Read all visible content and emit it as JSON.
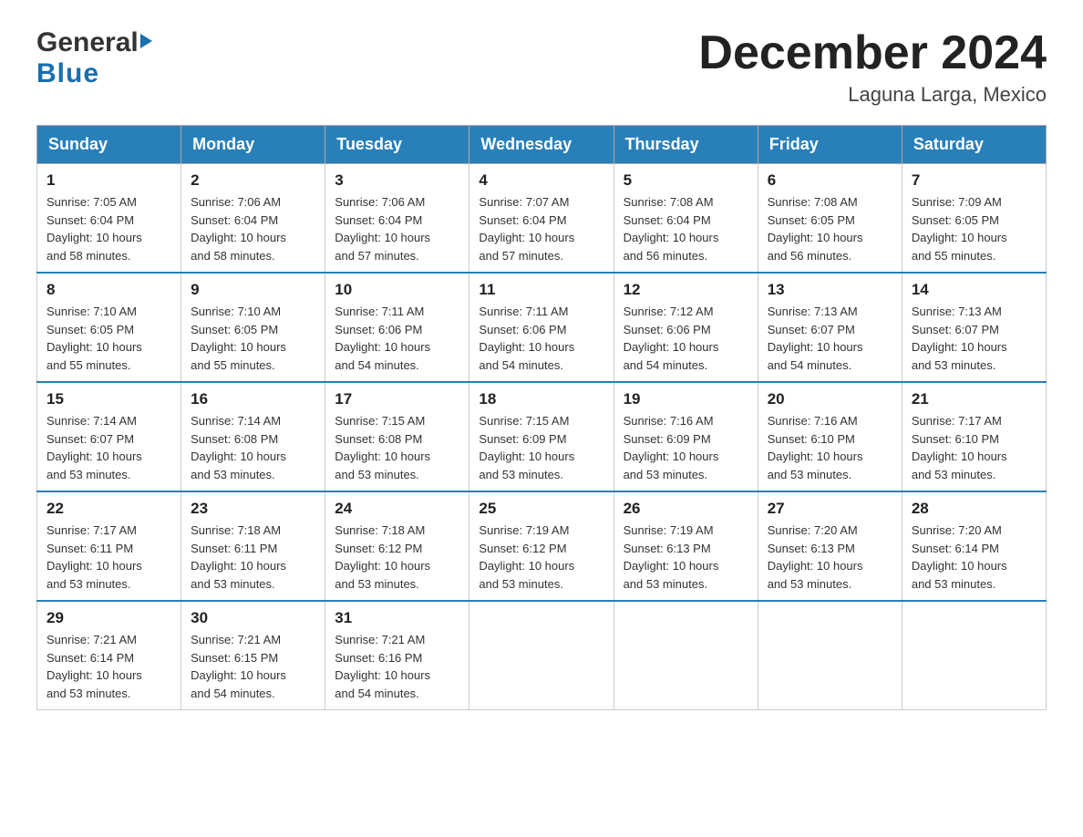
{
  "header": {
    "logo": {
      "general": "General",
      "blue": "Blue"
    },
    "title": "December 2024",
    "location": "Laguna Larga, Mexico"
  },
  "days_of_week": [
    "Sunday",
    "Monday",
    "Tuesday",
    "Wednesday",
    "Thursday",
    "Friday",
    "Saturday"
  ],
  "weeks": [
    [
      {
        "day": "1",
        "sunrise": "7:05 AM",
        "sunset": "6:04 PM",
        "daylight": "10 hours and 58 minutes."
      },
      {
        "day": "2",
        "sunrise": "7:06 AM",
        "sunset": "6:04 PM",
        "daylight": "10 hours and 58 minutes."
      },
      {
        "day": "3",
        "sunrise": "7:06 AM",
        "sunset": "6:04 PM",
        "daylight": "10 hours and 57 minutes."
      },
      {
        "day": "4",
        "sunrise": "7:07 AM",
        "sunset": "6:04 PM",
        "daylight": "10 hours and 57 minutes."
      },
      {
        "day": "5",
        "sunrise": "7:08 AM",
        "sunset": "6:04 PM",
        "daylight": "10 hours and 56 minutes."
      },
      {
        "day": "6",
        "sunrise": "7:08 AM",
        "sunset": "6:05 PM",
        "daylight": "10 hours and 56 minutes."
      },
      {
        "day": "7",
        "sunrise": "7:09 AM",
        "sunset": "6:05 PM",
        "daylight": "10 hours and 55 minutes."
      }
    ],
    [
      {
        "day": "8",
        "sunrise": "7:10 AM",
        "sunset": "6:05 PM",
        "daylight": "10 hours and 55 minutes."
      },
      {
        "day": "9",
        "sunrise": "7:10 AM",
        "sunset": "6:05 PM",
        "daylight": "10 hours and 55 minutes."
      },
      {
        "day": "10",
        "sunrise": "7:11 AM",
        "sunset": "6:06 PM",
        "daylight": "10 hours and 54 minutes."
      },
      {
        "day": "11",
        "sunrise": "7:11 AM",
        "sunset": "6:06 PM",
        "daylight": "10 hours and 54 minutes."
      },
      {
        "day": "12",
        "sunrise": "7:12 AM",
        "sunset": "6:06 PM",
        "daylight": "10 hours and 54 minutes."
      },
      {
        "day": "13",
        "sunrise": "7:13 AM",
        "sunset": "6:07 PM",
        "daylight": "10 hours and 54 minutes."
      },
      {
        "day": "14",
        "sunrise": "7:13 AM",
        "sunset": "6:07 PM",
        "daylight": "10 hours and 53 minutes."
      }
    ],
    [
      {
        "day": "15",
        "sunrise": "7:14 AM",
        "sunset": "6:07 PM",
        "daylight": "10 hours and 53 minutes."
      },
      {
        "day": "16",
        "sunrise": "7:14 AM",
        "sunset": "6:08 PM",
        "daylight": "10 hours and 53 minutes."
      },
      {
        "day": "17",
        "sunrise": "7:15 AM",
        "sunset": "6:08 PM",
        "daylight": "10 hours and 53 minutes."
      },
      {
        "day": "18",
        "sunrise": "7:15 AM",
        "sunset": "6:09 PM",
        "daylight": "10 hours and 53 minutes."
      },
      {
        "day": "19",
        "sunrise": "7:16 AM",
        "sunset": "6:09 PM",
        "daylight": "10 hours and 53 minutes."
      },
      {
        "day": "20",
        "sunrise": "7:16 AM",
        "sunset": "6:10 PM",
        "daylight": "10 hours and 53 minutes."
      },
      {
        "day": "21",
        "sunrise": "7:17 AM",
        "sunset": "6:10 PM",
        "daylight": "10 hours and 53 minutes."
      }
    ],
    [
      {
        "day": "22",
        "sunrise": "7:17 AM",
        "sunset": "6:11 PM",
        "daylight": "10 hours and 53 minutes."
      },
      {
        "day": "23",
        "sunrise": "7:18 AM",
        "sunset": "6:11 PM",
        "daylight": "10 hours and 53 minutes."
      },
      {
        "day": "24",
        "sunrise": "7:18 AM",
        "sunset": "6:12 PM",
        "daylight": "10 hours and 53 minutes."
      },
      {
        "day": "25",
        "sunrise": "7:19 AM",
        "sunset": "6:12 PM",
        "daylight": "10 hours and 53 minutes."
      },
      {
        "day": "26",
        "sunrise": "7:19 AM",
        "sunset": "6:13 PM",
        "daylight": "10 hours and 53 minutes."
      },
      {
        "day": "27",
        "sunrise": "7:20 AM",
        "sunset": "6:13 PM",
        "daylight": "10 hours and 53 minutes."
      },
      {
        "day": "28",
        "sunrise": "7:20 AM",
        "sunset": "6:14 PM",
        "daylight": "10 hours and 53 minutes."
      }
    ],
    [
      {
        "day": "29",
        "sunrise": "7:21 AM",
        "sunset": "6:14 PM",
        "daylight": "10 hours and 53 minutes."
      },
      {
        "day": "30",
        "sunrise": "7:21 AM",
        "sunset": "6:15 PM",
        "daylight": "10 hours and 54 minutes."
      },
      {
        "day": "31",
        "sunrise": "7:21 AM",
        "sunset": "6:16 PM",
        "daylight": "10 hours and 54 minutes."
      },
      null,
      null,
      null,
      null
    ]
  ],
  "labels": {
    "sunrise": "Sunrise:",
    "sunset": "Sunset:",
    "daylight": "Daylight:"
  }
}
